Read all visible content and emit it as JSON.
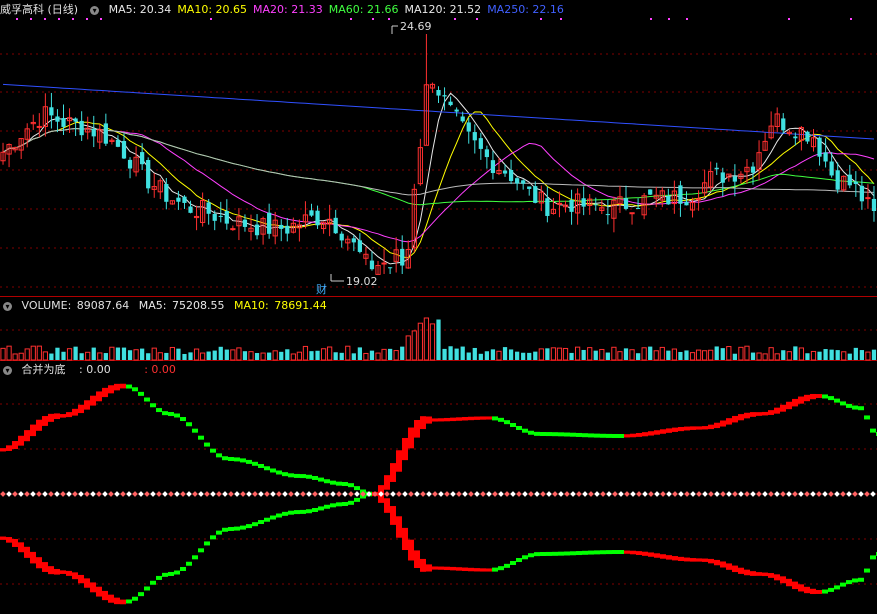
{
  "main_header": {
    "title": "威孚高科 (日线)",
    "ma": [
      {
        "label": "MA5:",
        "value": "20.34",
        "color": "#e8e8e8"
      },
      {
        "label": "MA10:",
        "value": "20.65",
        "color": "#ffff00"
      },
      {
        "label": "MA20:",
        "value": "21.33",
        "color": "#ff40ff"
      },
      {
        "label": "MA60:",
        "value": "21.66",
        "color": "#40ff40"
      },
      {
        "label": "MA120:",
        "value": "21.52",
        "color": "#e8e8e8"
      },
      {
        "label": "MA250:",
        "value": "22.16",
        "color": "#4060ff"
      }
    ]
  },
  "annotations": {
    "high": "24.69",
    "low": "19.02",
    "marker": "财"
  },
  "volume_header": {
    "label": "VOLUME:",
    "value": "89087.64",
    "ma5_label": "MA5:",
    "ma5_value": "75208.55",
    "ma10_label": "MA10:",
    "ma10_value": "78691.44"
  },
  "indicator_header": {
    "name": "合并为底",
    "v1": ": 0.00",
    "v2": ": 0.00"
  },
  "colors": {
    "up": "#ff3030",
    "down": "#40e0e0",
    "grid": "#800000",
    "ind_red": "#ff0000",
    "ind_green": "#00ff00"
  },
  "chart_data": {
    "type": "candlestick",
    "price_marks": {
      "max": 24.69,
      "min": 19.02
    },
    "close_trend": [
      21.9,
      22.4,
      22.8,
      22.6,
      22.5,
      22.3,
      21.9,
      21.3,
      20.9,
      20.6,
      20.5,
      20.3,
      20.2,
      20.1,
      20.1,
      20.3,
      20.4,
      19.9,
      19.2,
      19.3,
      19.6,
      23.8,
      22.9,
      22.2,
      21.7,
      21.4,
      20.9,
      20.6,
      20.7,
      20.6,
      20.6,
      20.7,
      20.8,
      20.8,
      20.9,
      21.3,
      21.4,
      21.6,
      22.7,
      22.5,
      22.3,
      21.3,
      21.1,
      20.4
    ],
    "indicator_values": {
      "v1": 0.0,
      "v2": 0.0
    }
  }
}
